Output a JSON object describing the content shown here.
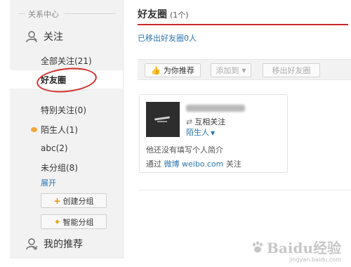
{
  "sidebar": {
    "section_title": "关系中心",
    "follow": "关注",
    "all_following": "全部关注(21)",
    "friends_circle": "好友圈",
    "special": "特别关注(0)",
    "strangers": "陌生人(1)",
    "abc": "abc(2)",
    "ungrouped": "未分组(8)",
    "expand": "展开",
    "create_group": "创建分组",
    "smart_group": "智能分组",
    "my_recommend": "我的推荐"
  },
  "main": {
    "title": "好友圈",
    "count": "(1个)",
    "removed_link": "已移出好友圈0人",
    "toolbar": {
      "recommend": "为你推荐",
      "add_to": "添加到",
      "remove": "移出好友圈"
    },
    "card": {
      "mutual": "互相关注",
      "tag": "陌生人",
      "bio": "他还没有填写个人简介",
      "via_prefix": "通过",
      "via_link": "微博 weibo.com",
      "via_suffix": "关注"
    }
  },
  "watermark": {
    "text": "Baidu经验",
    "sub": "jingyan.baidu.com"
  },
  "colors": {
    "accent_red": "#c8282a",
    "link_blue": "#2a74b0",
    "orange": "#f08c00"
  },
  "icons": [
    "person-icon",
    "thumbs-up-icon",
    "swap-icon",
    "plus-icon",
    "magic-wand-icon",
    "dropdown-arrow-icon"
  ]
}
